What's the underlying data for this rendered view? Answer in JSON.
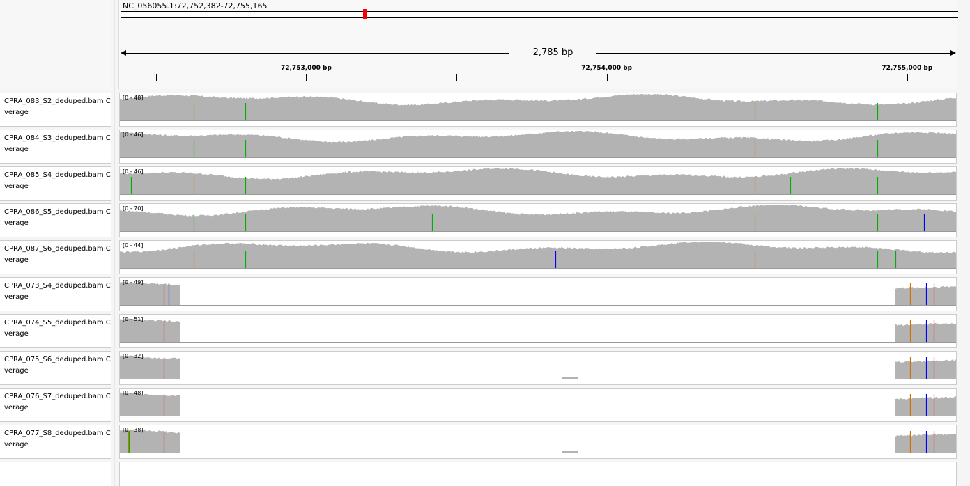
{
  "locus": "NC_056055.1:72,752,382-72,755,165",
  "span_label": "2,785 bp",
  "region": {
    "start": 72752382,
    "end": 72755165
  },
  "ideogram_marker_fraction": 0.291,
  "ruler": {
    "ticks": [
      72752500,
      72753000,
      72753500,
      72754000,
      72754500,
      72755000
    ],
    "labeled_ticks": [
      {
        "pos": 72753000,
        "label": "72,753,000 bp"
      },
      {
        "pos": 72754000,
        "label": "72,754,000 bp"
      },
      {
        "pos": 72755000,
        "label": "72,755,000 bp"
      }
    ]
  },
  "colors": {
    "coverage": "#b3b3b3",
    "A": "#00b000",
    "C": "#0000ff",
    "G": "#d17105",
    "T": "#ff0000"
  },
  "tracks": [
    {
      "name_line1": "CPRA_083_S2_deduped.bam Co",
      "name_line2": "verage",
      "range": "[0 - 48]",
      "profile": "full",
      "mismatches": [
        {
          "pos": 72752627,
          "color": "#d17105"
        },
        {
          "pos": 72752800,
          "color": "#00b000"
        },
        {
          "pos": 72754494,
          "color": "#d17105"
        },
        {
          "pos": 72754903,
          "color": "#00b000"
        }
      ]
    },
    {
      "name_line1": "CPRA_084_S3_deduped.bam Co",
      "name_line2": "verage",
      "range": "[0 - 46]",
      "profile": "full",
      "mismatches": [
        {
          "pos": 72752627,
          "color": "#00b000"
        },
        {
          "pos": 72752800,
          "color": "#00b000"
        },
        {
          "pos": 72754494,
          "color": "#d17105"
        },
        {
          "pos": 72754903,
          "color": "#00b000"
        }
      ]
    },
    {
      "name_line1": "CPRA_085_S4_deduped.bam Co",
      "name_line2": "verage",
      "range": "[0 - 46]",
      "profile": "full",
      "mismatches": [
        {
          "pos": 72752418,
          "color": "#00b000"
        },
        {
          "pos": 72752627,
          "color": "#d17105"
        },
        {
          "pos": 72752800,
          "color": "#00b000"
        },
        {
          "pos": 72754494,
          "color": "#d17105"
        },
        {
          "pos": 72754614,
          "color": "#00b000"
        },
        {
          "pos": 72754903,
          "color": "#00b000"
        }
      ]
    },
    {
      "name_line1": "CPRA_086_S5_deduped.bam Co",
      "name_line2": "verage",
      "range": "[0 - 70]",
      "profile": "full",
      "mismatches": [
        {
          "pos": 72752627,
          "color": "#00b000"
        },
        {
          "pos": 72752800,
          "color": "#00b000"
        },
        {
          "pos": 72753422,
          "color": "#00b000"
        },
        {
          "pos": 72754494,
          "color": "#d17105"
        },
        {
          "pos": 72754903,
          "color": "#00b000"
        },
        {
          "pos": 72755058,
          "color": "#0000ff"
        }
      ]
    },
    {
      "name_line1": "CPRA_087_S6_deduped.bam Co",
      "name_line2": "verage",
      "range": "[0 - 44]",
      "profile": "full",
      "mismatches": [
        {
          "pos": 72752627,
          "color": "#d17105"
        },
        {
          "pos": 72752800,
          "color": "#00b000"
        },
        {
          "pos": 72753831,
          "color": "#0000ff"
        },
        {
          "pos": 72754494,
          "color": "#d17105"
        },
        {
          "pos": 72754903,
          "color": "#00b000"
        },
        {
          "pos": 72754963,
          "color": "#00b000"
        }
      ]
    },
    {
      "name_line1": "CPRA_073_S4_deduped.bam Co",
      "name_line2": "verage",
      "range": "[0 - 49]",
      "profile": "ends",
      "mismatches": [
        {
          "pos": 72752528,
          "color": "#ff0000"
        },
        {
          "pos": 72752545,
          "color": "#0000ff"
        },
        {
          "pos": 72755012,
          "color": "#d17105"
        },
        {
          "pos": 72755065,
          "color": "#0000ff"
        },
        {
          "pos": 72755091,
          "color": "#ff0000"
        }
      ]
    },
    {
      "name_line1": "CPRA_074_S5_deduped.bam Co",
      "name_line2": "verage",
      "range": "[0 - 51]",
      "profile": "ends",
      "mismatches": [
        {
          "pos": 72752528,
          "color": "#ff0000"
        },
        {
          "pos": 72755012,
          "color": "#d17105"
        },
        {
          "pos": 72755065,
          "color": "#0000ff"
        },
        {
          "pos": 72755091,
          "color": "#ff0000"
        }
      ]
    },
    {
      "name_line1": "CPRA_075_S6_deduped.bam Co",
      "name_line2": "verage",
      "range": "[0 - 32]",
      "profile": "ends_mid",
      "mismatches": [
        {
          "pos": 72752528,
          "color": "#ff0000"
        },
        {
          "pos": 72755012,
          "color": "#d17105"
        },
        {
          "pos": 72755065,
          "color": "#0000ff"
        },
        {
          "pos": 72755091,
          "color": "#ff0000"
        }
      ]
    },
    {
      "name_line1": "CPRA_076_S7_deduped.bam Co",
      "name_line2": "verage",
      "range": "[0 - 48]",
      "profile": "ends",
      "mismatches": [
        {
          "pos": 72752528,
          "color": "#ff0000"
        },
        {
          "pos": 72755012,
          "color": "#d17105"
        },
        {
          "pos": 72755065,
          "color": "#0000ff"
        },
        {
          "pos": 72755091,
          "color": "#ff0000"
        }
      ]
    },
    {
      "name_line1": "CPRA_077_S8_deduped.bam Co",
      "name_line2": "verage",
      "range": "[0 - 38]",
      "profile": "ends_mid",
      "mismatches": [
        {
          "pos": 72752410,
          "color": "#d17105"
        },
        {
          "pos": 72752413,
          "color": "#00b000"
        },
        {
          "pos": 72752528,
          "color": "#ff0000"
        },
        {
          "pos": 72755012,
          "color": "#d17105"
        },
        {
          "pos": 72755065,
          "color": "#0000ff"
        },
        {
          "pos": 72755091,
          "color": "#ff0000"
        }
      ]
    }
  ]
}
